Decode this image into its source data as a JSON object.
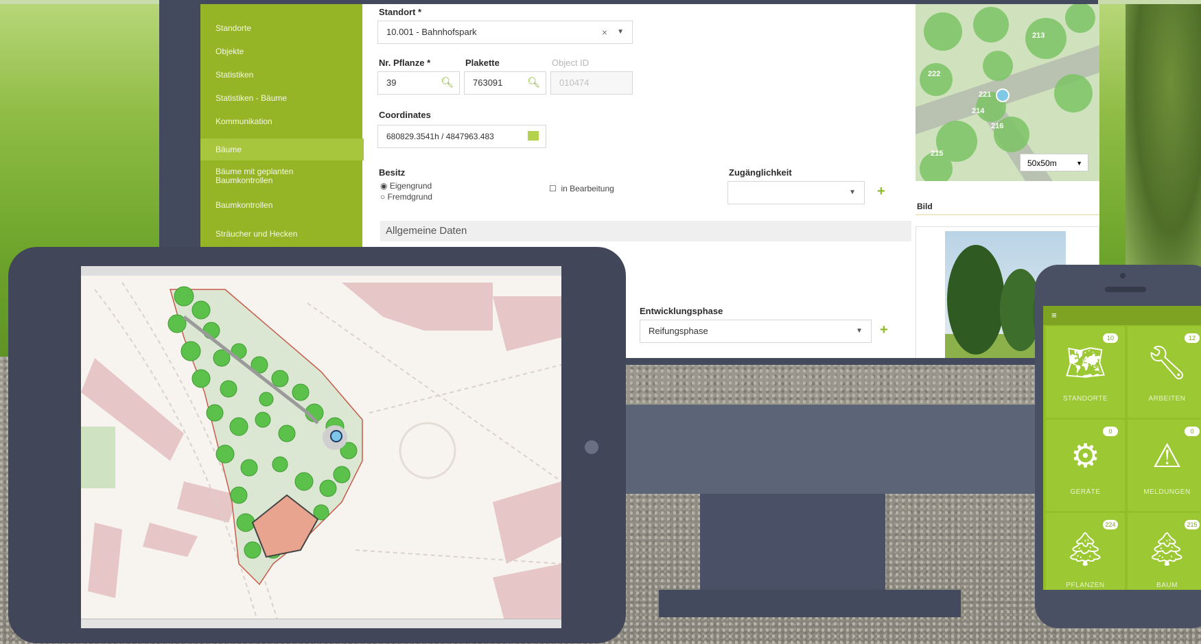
{
  "sidebar": {
    "items": [
      {
        "label": "Standorte"
      },
      {
        "label": "Objekte"
      },
      {
        "label": "Statistiken"
      },
      {
        "label": "Statistiken - Bäume"
      },
      {
        "label": "Kommunikation"
      },
      {
        "label": "Bäume",
        "active": true
      },
      {
        "label": "Bäume mit geplanten Baumkontrollen"
      },
      {
        "label": "Baumkontrollen"
      },
      {
        "label": "Sträucher und Hecken"
      }
    ]
  },
  "form": {
    "standort_label": "Standort *",
    "standort_value": "10.001 - Bahnhofspark",
    "nr_pflanze_label": "Nr. Pflanze *",
    "nr_pflanze_value": "39",
    "plakette_label": "Plakette",
    "plakette_value": "763091",
    "object_id_label": "Object ID",
    "object_id_value": "010474",
    "coordinates_label": "Coordinates",
    "coordinates_value": "680829.3541h / 4847963.483",
    "besitz_label": "Besitz",
    "besitz_options": [
      "Eigengrund",
      "Fremdgrund"
    ],
    "in_bearbeitung_label": "in Bearbeitung",
    "zugaenglichkeit_label": "Zugänglichkeit",
    "section_title": "Allgemeine Daten",
    "entwicklungsphase_label": "Entwicklungsphase",
    "entwicklungsphase_value": "Reifungsphase",
    "bild_label": "Bild"
  },
  "map_panel": {
    "scale_select": "50x50m",
    "tree_numbers": [
      "222",
      "214",
      "215",
      "221",
      "213",
      "216"
    ]
  },
  "phone": {
    "tiles": [
      {
        "label": "STANDORTE",
        "icon": "map-icon",
        "badge": "10"
      },
      {
        "label": "ARBEITEN",
        "icon": "wrench-icon",
        "badge": "12"
      },
      {
        "label": "GERÄTE",
        "icon": "device-icon",
        "badge": "0"
      },
      {
        "label": "MELDUNGEN",
        "icon": "warning-icon",
        "badge": "0"
      },
      {
        "label": "PFLANZEN",
        "icon": "tree-icon",
        "badge": "224"
      },
      {
        "label": "BAUM",
        "icon": "tree-list-icon",
        "badge": "215"
      }
    ]
  },
  "colors": {
    "brand_green": "#95b527",
    "device_frame": "#434a5e"
  }
}
